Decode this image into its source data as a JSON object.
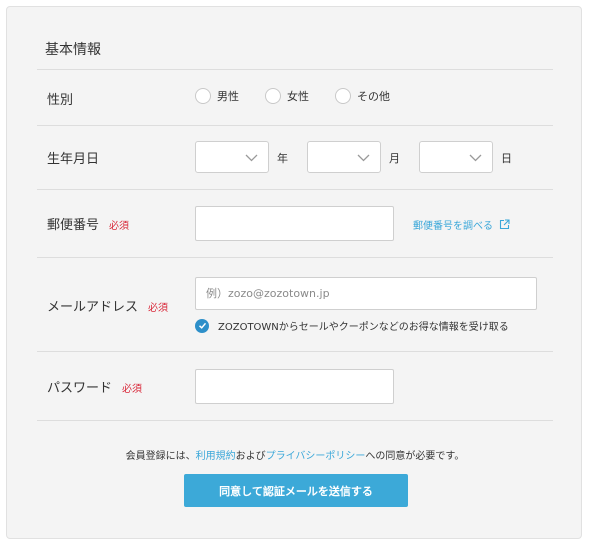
{
  "form": {
    "section_title": "基本情報",
    "gender": {
      "label": "性別",
      "options": [
        "男性",
        "女性",
        "その他"
      ]
    },
    "birthdate": {
      "label": "生年月日",
      "year_unit": "年",
      "month_unit": "月",
      "day_unit": "日"
    },
    "postal": {
      "label": "郵便番号",
      "required": "必須",
      "lookup_link": "郵便番号を調べる"
    },
    "email": {
      "label": "メールアドレス",
      "required": "必須",
      "placeholder": "例）zozo@zozotown.jp",
      "optin_text": "ZOZOTOWNからセールやクーポンなどのお得な情報を受け取る",
      "optin_checked": true
    },
    "password": {
      "label": "パスワード",
      "required": "必須"
    },
    "consent": {
      "prefix": "会員登録には、",
      "terms_link": "利用規約",
      "middle": "および",
      "privacy_link": "プライバシーポリシー",
      "suffix": "への同意が必要です。"
    },
    "submit_label": "同意して認証メールを送信する"
  },
  "colors": {
    "accent": "#3ca9d8",
    "link": "#3aa7d9",
    "required": "#d9283a",
    "panel_bg": "#f4f4f4"
  },
  "icons": {
    "select_arrow": "chevron-down-icon",
    "external_link": "external-link-icon",
    "optin_check": "check-icon"
  }
}
